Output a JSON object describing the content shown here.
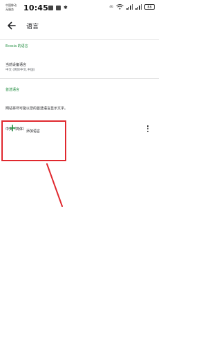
{
  "status_bar": {
    "carrier_line1": "中国移动",
    "carrier_line2": "无服务",
    "time": "10:45",
    "network_label": "4G",
    "battery": "88",
    "icons": [
      "notification-icon",
      "notification-icon",
      "bluetooth-icon",
      "wifi-icon",
      "signal-icon",
      "battery-icon"
    ]
  },
  "app_bar": {
    "back_icon": "arrow-left-icon",
    "title": "语言"
  },
  "sections": {
    "app_language_header": "Ecosia 的语言",
    "current_device_language_title": "当前设备语言",
    "current_device_language_value": "中文 (简体中文,中国)",
    "preferred_header": "首选语言",
    "preferred_description": "网站将尽可能以您的首选语言显示文字。",
    "preferred_items": [
      {
        "label": "中文（简体）",
        "more_icon": "more-vertical-icon"
      }
    ],
    "add_language_label": "添加语言",
    "add_language_icon": "plus-icon"
  },
  "colors": {
    "accent_green": "#1a8a3a",
    "annotation_red": "#e0282e"
  }
}
